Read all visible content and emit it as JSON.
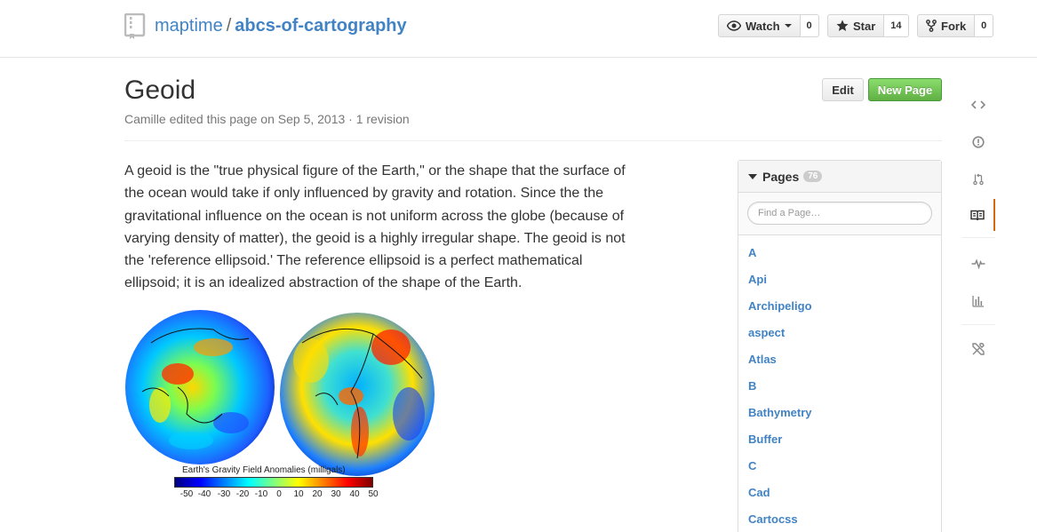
{
  "header": {
    "owner": "maptime",
    "separator": "/",
    "repo": "abcs-of-cartography",
    "watch": {
      "label": "Watch",
      "count": "0"
    },
    "star": {
      "label": "Star",
      "count": "14"
    },
    "fork": {
      "label": "Fork",
      "count": "0"
    }
  },
  "page": {
    "title": "Geoid",
    "meta": "Camille edited this page on Sep 5, 2013 · 1 revision",
    "edit_label": "Edit",
    "new_page_label": "New Page",
    "body": "A geoid is the \"true physical figure of the Earth,\" or the shape that the surface of the ocean would take if only influenced by gravity and rotation. Since the the gravitational influence on the ocean is not uniform across the globe (because of varying density of matter), the geoid is a highly irregular shape. The geoid is not the 'reference ellipsoid.' The reference ellipsoid is a perfect mathematical ellipsoid; it is an idealized abstraction of the shape of the Earth."
  },
  "figure": {
    "colorbar_label": "Earth's Gravity Field Anomalies (milligals)",
    "ticks": [
      "-50",
      "-40",
      "-30",
      "-20",
      "-10",
      "0",
      "10",
      "20",
      "30",
      "40",
      "50"
    ]
  },
  "sidebar": {
    "heading": "Pages",
    "count": "76",
    "search_placeholder": "Find a Page…",
    "pages": [
      "A",
      "Api",
      "Archipeligo",
      "aspect",
      "Atlas",
      "B",
      "Bathymetry",
      "Buffer",
      "C",
      "Cad",
      "Cartocss"
    ]
  },
  "rail": {
    "items": [
      "code-icon",
      "issues-icon",
      "pull-requests-icon",
      "wiki-icon",
      "pulse-icon",
      "graphs-icon",
      "settings-icon"
    ],
    "active": "wiki-icon",
    "active_color": "#d26911"
  },
  "colors": {
    "link": "#4183c4",
    "new_page_button": "#60b044"
  }
}
